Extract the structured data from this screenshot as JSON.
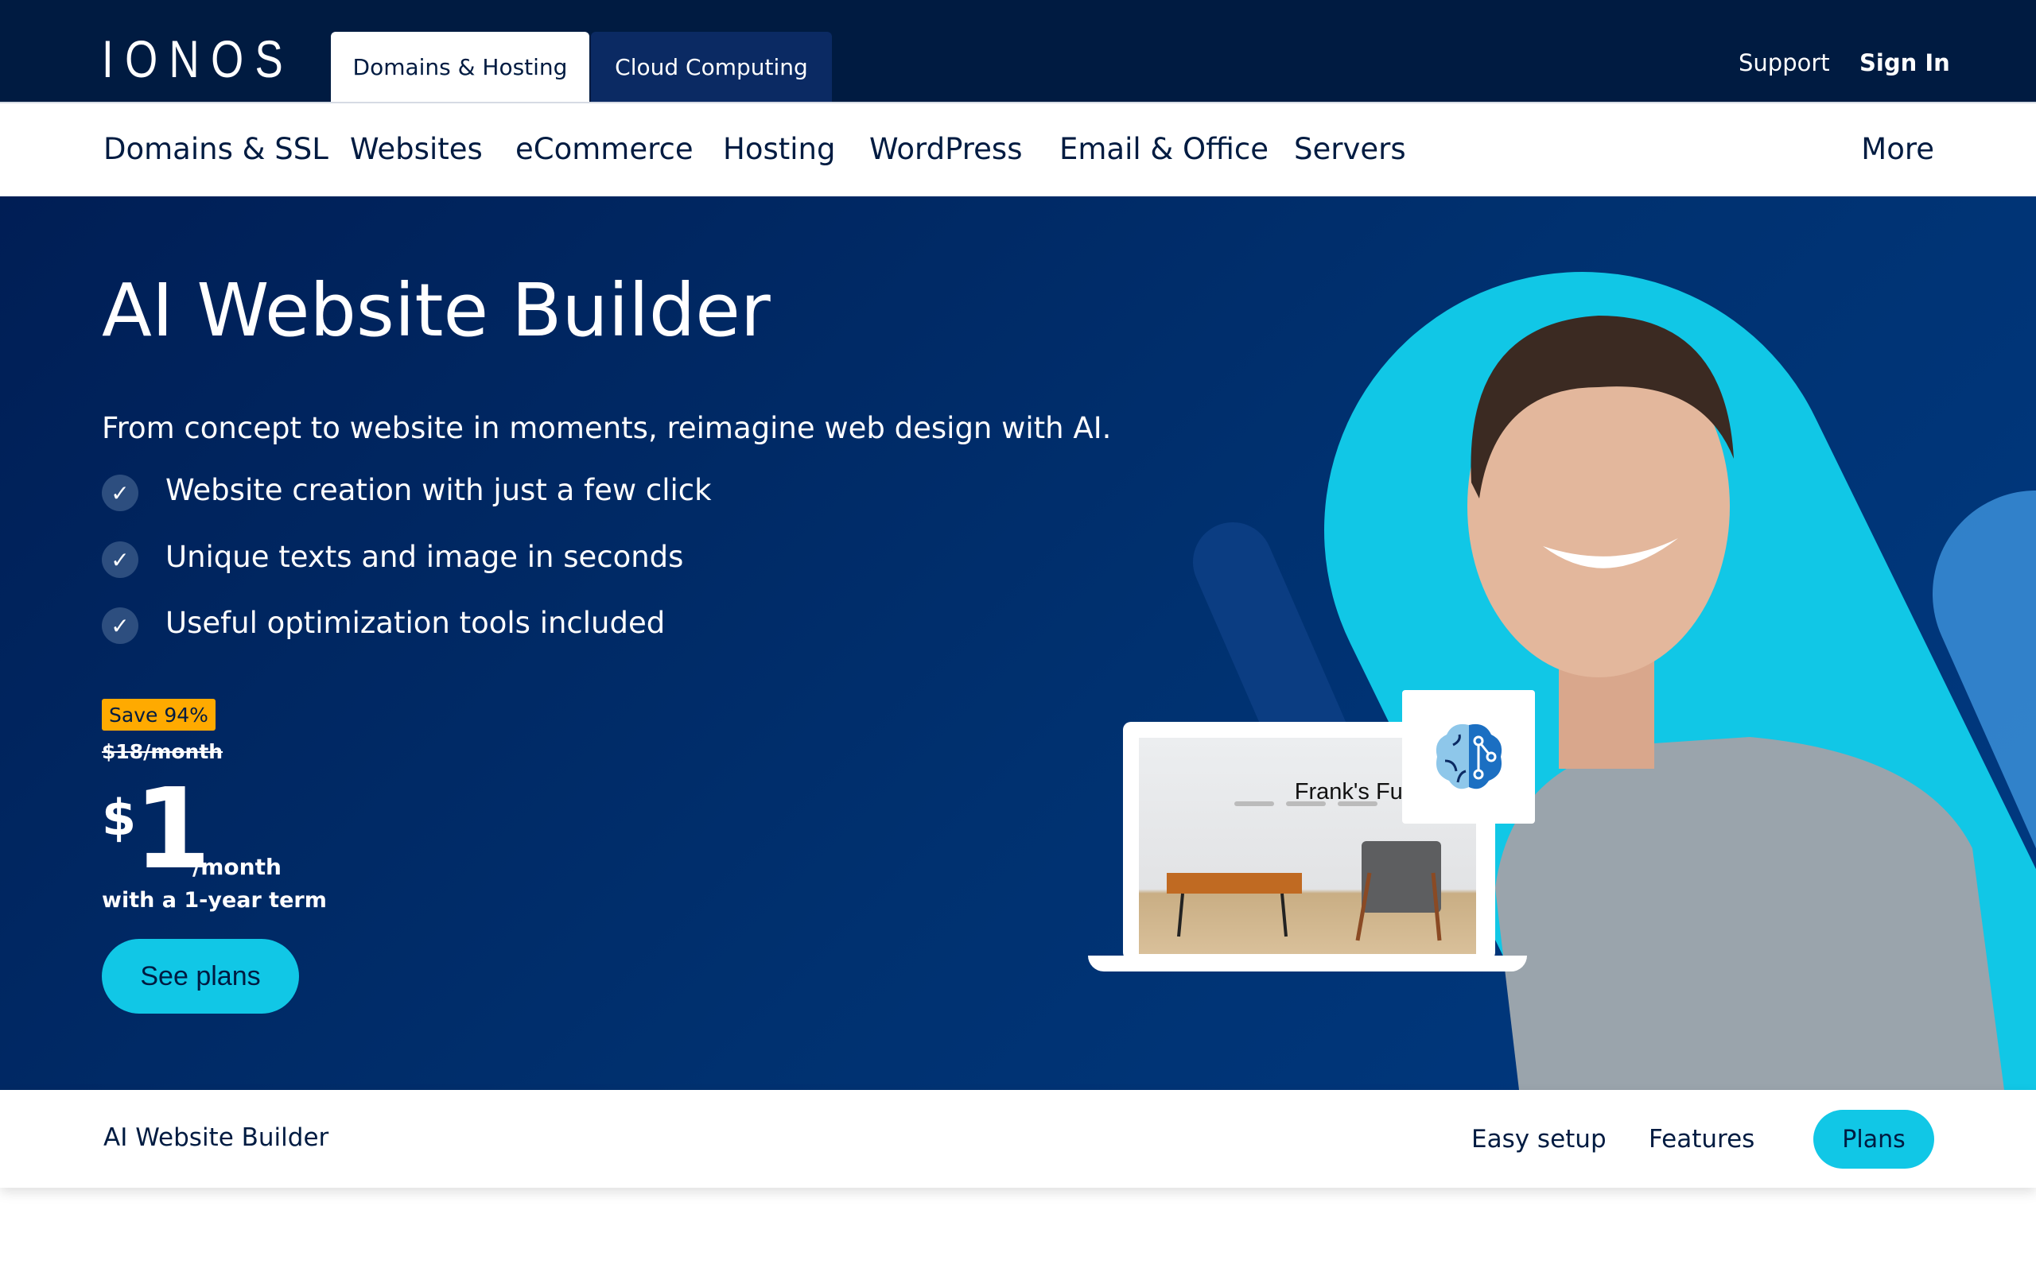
{
  "header": {
    "logo": "IONOS",
    "tabs": [
      {
        "label": "Domains & Hosting",
        "active": true
      },
      {
        "label": "Cloud Computing",
        "active": false
      }
    ],
    "support": "Support",
    "sign_in": "Sign In"
  },
  "nav": {
    "items": [
      "Domains & SSL",
      "Websites",
      "eCommerce",
      "Hosting",
      "WordPress",
      "Email & Office",
      "Servers"
    ],
    "more": "More"
  },
  "hero": {
    "title": "AI Website Builder",
    "subtitle": "From concept to website in moments, reimagine web design with AI.",
    "features": [
      "Website creation with just a few click",
      "Unique texts and image in seconds",
      "Useful optimization tools included"
    ],
    "check_icon": "✓",
    "badge": "Save 94%",
    "old_price": "$18/month",
    "currency": "$",
    "price": "1",
    "per": "/month",
    "term": "with a 1-year term",
    "cta": "See plans",
    "mockup_title": "Frank's Furniture"
  },
  "subnav": {
    "title": "AI Website Builder",
    "links": [
      "Easy setup",
      "Features"
    ],
    "plans": "Plans"
  },
  "colors": {
    "navy": "#001b41",
    "accent": "#11c7e6",
    "badge": "#ffaa00"
  }
}
